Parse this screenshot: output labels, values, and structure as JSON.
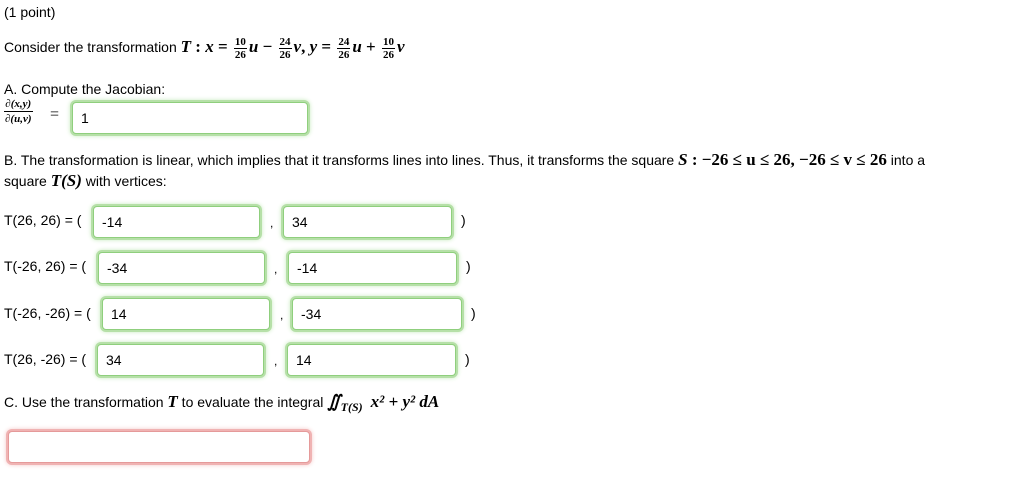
{
  "header": {
    "points": "(1 point)"
  },
  "problem": {
    "intro": "Consider the transformation ",
    "T": "T",
    "colon": " : ",
    "x": "x",
    "eq": " = ",
    "f1_num": "10",
    "f1_den": "26",
    "u1": "u",
    "minus": " − ",
    "f2_num": "24",
    "f2_den": "26",
    "v1": "v",
    "sep": ",  ",
    "y": "y",
    "eq2": " = ",
    "f3_num": "24",
    "f3_den": "26",
    "u2": "u",
    "plus": " + ",
    "f4_num": "10",
    "f4_den": "26",
    "v2": "v"
  },
  "partA": {
    "label": "A. Compute the Jacobian:",
    "jac_num": "∂(x,y)",
    "jac_den": "∂(u,v)",
    "eq": "=",
    "answer": "1"
  },
  "partB": {
    "text_line1_a": "B. The transformation is linear, which implies that it transforms lines into lines. Thus, it transforms the square ",
    "S": "S",
    "cond": " : −26 ≤ u ≤ 26, −26 ≤ v ≤ 26",
    "text_line1_b": " into a",
    "text_line2_a": "square ",
    "TS": "T(S)",
    "text_line2_b": " with vertices:",
    "rows": [
      {
        "label": "T(26, 26) = (",
        "a": "-14",
        "b": "34"
      },
      {
        "label": "T(-26, 26) = (",
        "a": "-34",
        "b": "-14"
      },
      {
        "label": "T(-26, -26) = (",
        "a": "14",
        "b": "-34"
      },
      {
        "label": "T(26, -26) = (",
        "a": "34",
        "b": "14"
      }
    ],
    "comma": ",",
    "close": ")"
  },
  "partC": {
    "text_a": "C. Use the transformation ",
    "T": "T",
    "text_b": " to evaluate the integral ",
    "integral": "∬",
    "region": "T(S)",
    "integrand": "x² + y² dA",
    "answer": ""
  }
}
